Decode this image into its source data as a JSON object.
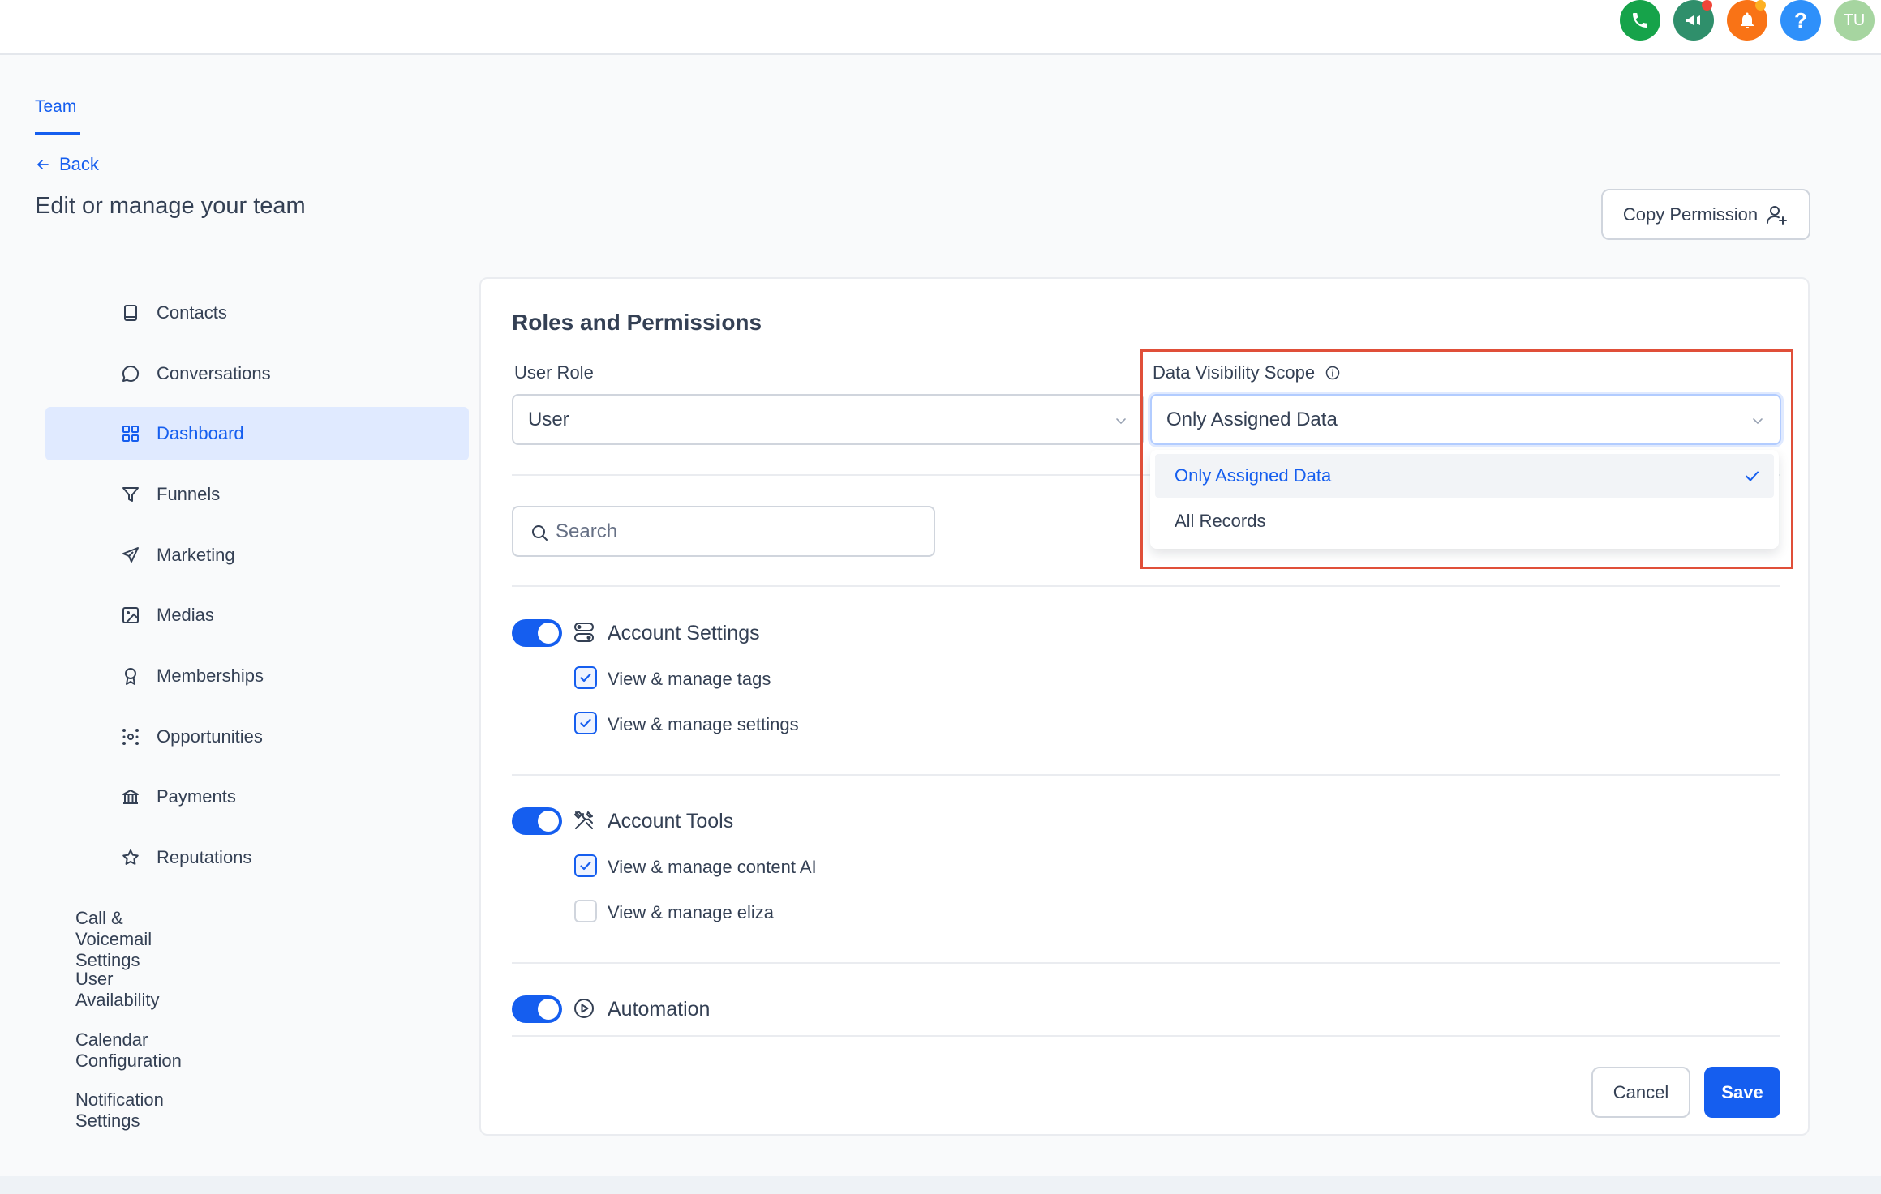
{
  "topbar": {
    "icons": [
      {
        "name": "phone-icon",
        "color": "#16a34a"
      },
      {
        "name": "megaphone-icon",
        "color": "#2f8f6b",
        "badge": "#f04438"
      },
      {
        "name": "bell-icon",
        "color": "#f97316",
        "badge": "#fdb022"
      },
      {
        "name": "help-icon",
        "color": "#2e90fa",
        "glyph": "?"
      },
      {
        "name": "avatar",
        "color": "#a6d5a0",
        "initials": "TU"
      }
    ]
  },
  "tabs": {
    "team": "Team"
  },
  "back_label": "Back",
  "page_title": "Edit or manage your team",
  "copy_permission_label": "Copy Permission",
  "sidebar": {
    "items": [
      {
        "label": "Contacts",
        "icon": "book-icon"
      },
      {
        "label": "Conversations",
        "icon": "chat-bubble-icon"
      },
      {
        "label": "Dashboard",
        "icon": "grid-icon",
        "active": true
      },
      {
        "label": "Funnels",
        "icon": "filter-icon"
      },
      {
        "label": "Marketing",
        "icon": "send-icon"
      },
      {
        "label": "Medias",
        "icon": "image-icon"
      },
      {
        "label": "Memberships",
        "icon": "badge-icon"
      },
      {
        "label": "Opportunities",
        "icon": "nodes-icon"
      },
      {
        "label": "Payments",
        "icon": "bank-icon"
      },
      {
        "label": "Reputations",
        "icon": "star-icon"
      }
    ],
    "plain_items": [
      "Call & Voicemail Settings",
      "User Availability",
      "Calendar Configuration",
      "Notification Settings"
    ]
  },
  "roles": {
    "title": "Roles and Permissions",
    "user_role_label": "User Role",
    "user_role_value": "User",
    "visibility_label": "Data Visibility Scope",
    "visibility_value": "Only Assigned Data",
    "visibility_options": [
      {
        "label": "Only Assigned Data",
        "selected": true
      },
      {
        "label": "All Records",
        "selected": false
      }
    ],
    "search_placeholder": "Search"
  },
  "sections": [
    {
      "title": "Account Settings",
      "icon": "settings-toggles-icon",
      "enabled": true,
      "permissions": [
        {
          "label": "View & manage tags",
          "checked": true
        },
        {
          "label": "View & manage settings",
          "checked": true
        }
      ]
    },
    {
      "title": "Account Tools",
      "icon": "tools-icon",
      "enabled": true,
      "permissions": [
        {
          "label": "View & manage content AI",
          "checked": true
        },
        {
          "label": "View & manage eliza",
          "checked": false
        }
      ]
    },
    {
      "title": "Automation",
      "icon": "play-circle-icon",
      "enabled": true,
      "permissions": []
    }
  ],
  "actions": {
    "cancel": "Cancel",
    "save": "Save"
  },
  "colors": {
    "accent": "#155eef",
    "highlight_border": "#e04f39"
  }
}
